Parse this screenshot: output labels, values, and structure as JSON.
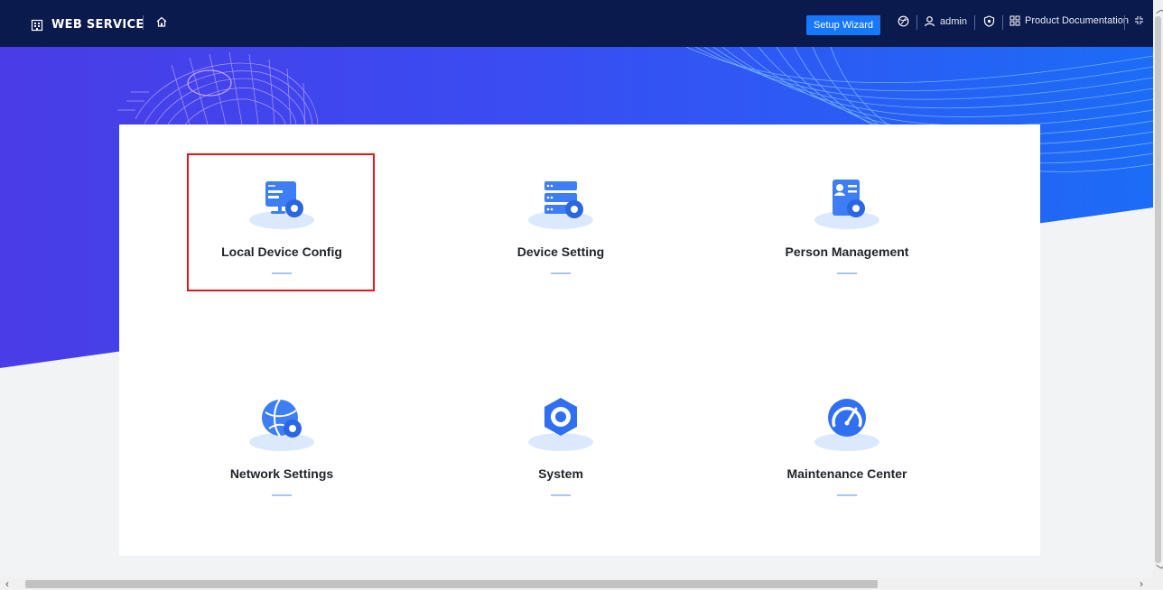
{
  "header": {
    "brand": "WEB SERVICE",
    "setup_wizard": "Setup Wizard",
    "user": "admin",
    "docs": "Product Documentation"
  },
  "tiles": [
    {
      "label": "Local Device Config",
      "icon": "monitor-settings-icon"
    },
    {
      "label": "Device Setting",
      "icon": "server-settings-icon"
    },
    {
      "label": "Person Management",
      "icon": "person-card-icon"
    },
    {
      "label": "Network Settings",
      "icon": "globe-settings-icon"
    },
    {
      "label": "System",
      "icon": "gear-icon"
    },
    {
      "label": "Maintenance Center",
      "icon": "speedometer-icon"
    }
  ],
  "colors": {
    "topbar": "#0b1a4d",
    "accent": "#1677ff",
    "highlight": "#e2161e",
    "hero_blue": "#2f4ff0"
  }
}
